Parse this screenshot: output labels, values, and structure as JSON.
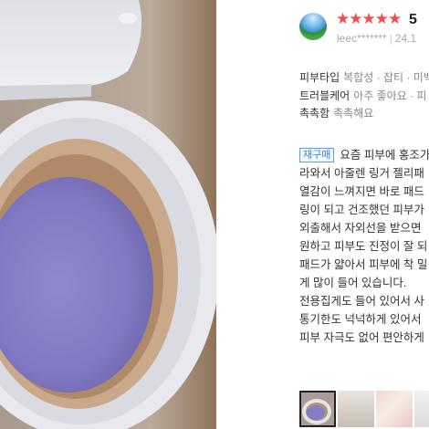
{
  "review": {
    "rating": {
      "stars": "★★★★★",
      "score": "5",
      "star_color": "#f04e4e"
    },
    "username": "leec*******",
    "date": "24.1",
    "attributes": [
      {
        "key": "피부타입",
        "value": "복합성 · 잡티 · 미백"
      },
      {
        "key": "트러블케어",
        "value": "아주 좋아요 · 피"
      },
      {
        "key": "촉촉함",
        "value": "촉촉해요"
      }
    ],
    "repurchase_badge": "재구매",
    "text_lines": [
      "요즘 피부에 홍조가",
      "라와서 아줄렌 링거 젤리패",
      "열감이 느껴지면 바로 패드",
      "링이 되고 건조했던 피부가",
      "외출해서 자외선을 받으면",
      "원하고 피부도 진정이 잘 되",
      "패드가 얇아서 피부에 착 밀",
      "게 많이 들어 있습니다.",
      "전용집게도 들어 있어서 사",
      "통기한도 넉넉하게 있어서",
      "피부 자극도 없어 편안하게"
    ],
    "photos": [
      "photo-1",
      "photo-2",
      "photo-3",
      "photo-4"
    ]
  }
}
